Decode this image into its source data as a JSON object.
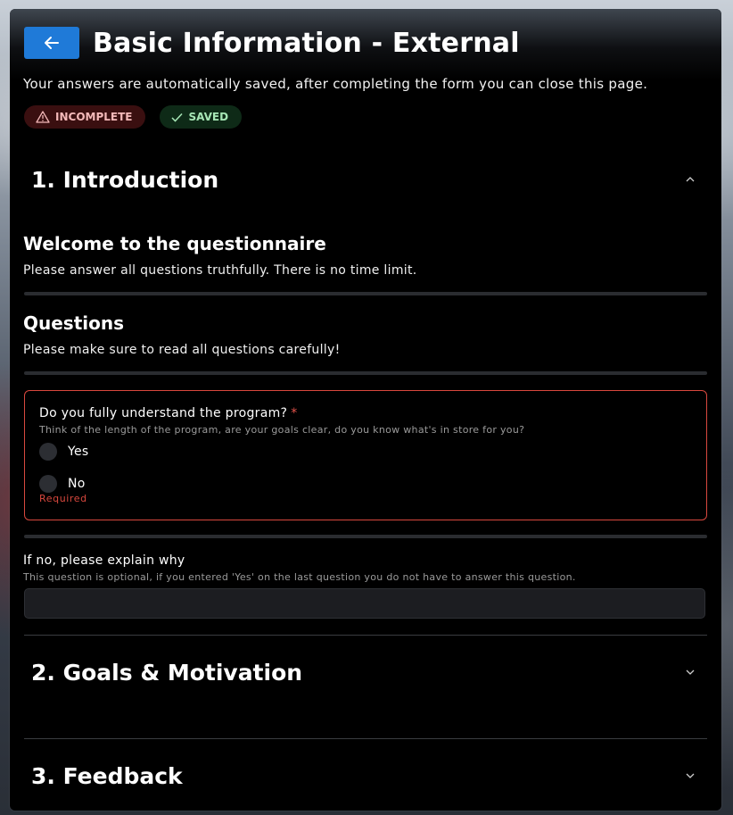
{
  "page": {
    "title": "Basic Information - External",
    "subtitle": "Your answers are automatically saved, after completing the form you can close this page."
  },
  "badges": {
    "incomplete": "INCOMPLETE",
    "saved": "SAVED"
  },
  "sections": [
    {
      "title": "1. Introduction",
      "expanded": true
    },
    {
      "title": "2. Goals & Motivation",
      "expanded": false
    },
    {
      "title": "3. Feedback",
      "expanded": false
    }
  ],
  "intro": {
    "welcome_title": "Welcome to the questionnaire",
    "welcome_desc": "Please answer all questions truthfully. There is no time limit.",
    "questions_title": "Questions",
    "questions_desc": "Please make sure to read all questions carefully!"
  },
  "question1": {
    "label": "Do you fully understand the program?",
    "required_mark": "*",
    "hint": "Think of the length of the program, are your goals clear, do you know what's in store for you?",
    "options": [
      "Yes",
      "No"
    ],
    "error": "Required"
  },
  "question2": {
    "label": "If no, please explain why",
    "hint": "This question is optional, if you entered 'Yes' on the last question you do not have to answer this question.",
    "value": ""
  },
  "colors": {
    "accent": "#1f7ad8",
    "error": "#d9483e",
    "incomplete_bg": "#3a0f10",
    "saved_bg": "#0e2a17"
  },
  "icons": {
    "back": "arrow-left-icon",
    "incomplete": "warning-triangle-icon",
    "saved": "check-icon",
    "expanded": "chevron-up-icon",
    "collapsed": "chevron-down-icon"
  }
}
